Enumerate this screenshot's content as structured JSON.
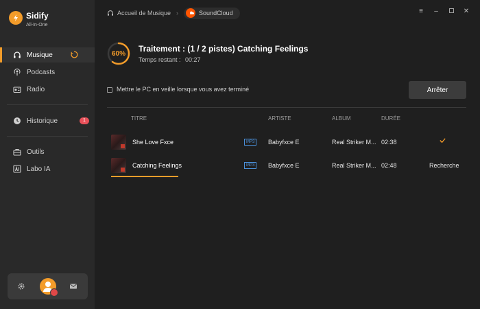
{
  "app": {
    "name": "Sidify",
    "subtitle": "All-In-One",
    "accent": "#f39c2a"
  },
  "sidebar": {
    "items": [
      {
        "label": "Musique",
        "icon": "headphones-icon",
        "active": true
      },
      {
        "label": "Podcasts",
        "icon": "podcast-icon"
      },
      {
        "label": "Radio",
        "icon": "radio-icon"
      },
      {
        "label": "Historique",
        "icon": "clock-icon",
        "badge": "1"
      },
      {
        "label": "Outils",
        "icon": "toolbox-icon"
      },
      {
        "label": "Labo IA",
        "icon": "ai-icon"
      }
    ],
    "bottom": {
      "icons": [
        "gear-icon",
        "avatar",
        "mail-icon"
      ]
    }
  },
  "header": {
    "home": "Accueil de Musique",
    "source": "SoundCloud",
    "window_controls": [
      "menu-icon",
      "minimize-icon",
      "maximize-icon",
      "close-icon"
    ]
  },
  "progress": {
    "percent_label": "60%",
    "percent": 60,
    "title": "Traitement : (1 / 2 pistes) Catching Feelings",
    "remaining_label": "Temps restant :",
    "remaining_value": "00:27"
  },
  "options": {
    "sleep_label": "Mettre le PC en veille lorsque vous avez terminé",
    "sleep_checked": false,
    "stop_label": "Arrêter"
  },
  "table": {
    "headers": {
      "title": "TITRE",
      "artist": "ARTISTE",
      "album": "ALBUM",
      "duration": "DURÉE"
    },
    "rows": [
      {
        "title": "She Love Fxce",
        "format": "MP3",
        "artist": "Babyfxce E",
        "album": "Real Striker M...",
        "duration": "02:38",
        "status": "done",
        "status_text": ""
      },
      {
        "title": "Catching Feelings",
        "format": "MP3",
        "artist": "Babyfxce E",
        "album": "Real Striker M...",
        "duration": "02:48",
        "status": "searching",
        "status_text": "Recherche"
      }
    ]
  }
}
